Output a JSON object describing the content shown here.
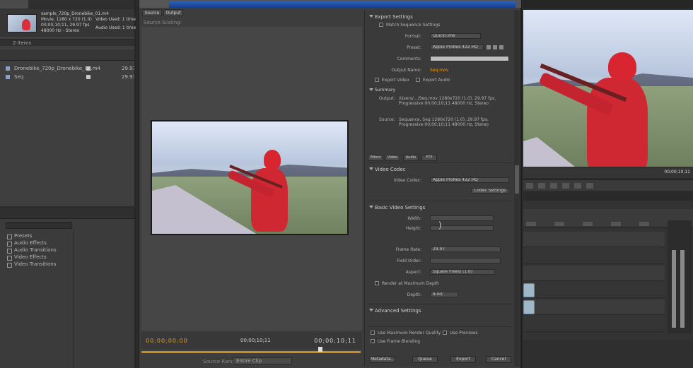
{
  "project": {
    "clip_name": "sample_720p_Dronebike_01.m4",
    "clip_line2": "Movie, 1280 x 720 (1.0)",
    "clip_line3": "00;00;10;11, 29.97 fps",
    "clip_line4": "48000 Hz - Stereo",
    "clip_r1": "Video Used: 1 time",
    "clip_r2": "Audio Used: 1 time",
    "item_count": "2 Items",
    "rows": [
      {
        "name": "Dronebike_720p_Dronebike_01.m4",
        "value": "29.97"
      },
      {
        "name": "Seq",
        "value": "29.97"
      }
    ]
  },
  "effects": {
    "items": [
      "Presets",
      "Audio Effects",
      "Audio Transitions",
      "Video Effects",
      "Video Transitions"
    ]
  },
  "dialog": {
    "source_tab": "Source",
    "output_tab": "Output",
    "source_scaling": "Source Scaling:",
    "tc_in": "00;00;00;00",
    "tc_mid": "00;00;10;11",
    "tc_out": "00;00;10;11",
    "fit_label": "Source Range:",
    "fit_value": "Entire Clip"
  },
  "settings": {
    "export_settings": "Export Settings",
    "match_seq": "Match Sequence Settings",
    "format_label": "Format:",
    "format_value": "QuickTime",
    "preset_label": "Preset:",
    "preset_value": "Apple ProRes 422 HQ",
    "comments_label": "Comments:",
    "output_label": "Output Name:",
    "output_value": "Seq.mov",
    "export_video": "Export Video",
    "export_audio": "Export Audio",
    "summary_label": "Summary",
    "output_summary": "Output:",
    "output_details": "/Users/.../Seq.mov 1280x720 (1.0), 29.97 fps, Progressive 00;00;10;11 48000 Hz, Stereo",
    "source_summary": "Source:",
    "source_details": "Sequence, Seq 1280x720 (1.0), 29.97 fps, Progressive 00;00;10;11 48000 Hz, Stereo",
    "tabs": [
      "Filters",
      "Video",
      "Audio",
      "FTP"
    ],
    "video_codec": "Video Codec",
    "codec_label": "Video Codec:",
    "codec_value": "Apple ProRes 422 HQ",
    "codec_settings": "Codec Settings",
    "basic_video": "Basic Video Settings",
    "width_label": "Width:",
    "height_label": "Height:",
    "frame_rate_label": "Frame Rate:",
    "frame_rate_value": "29.97",
    "field_order_label": "Field Order:",
    "aspect_label": "Aspect:",
    "aspect_value": "Square Pixels (1.0)",
    "render_depth": "Render at Maximum Depth",
    "depth_label": "Depth:",
    "depth_value": "8-bit",
    "advanced": "Advanced Settings",
    "use_max_render": "Use Maximum Render Quality",
    "use_previews": "Use Previews",
    "use_frame_blending": "Use Frame Blending",
    "btn_metadata": "Metadata...",
    "btn_queue": "Queue",
    "btn_export": "Export",
    "btn_cancel": "Cancel"
  },
  "monitor": {
    "timecode": "00;00;10;11"
  }
}
